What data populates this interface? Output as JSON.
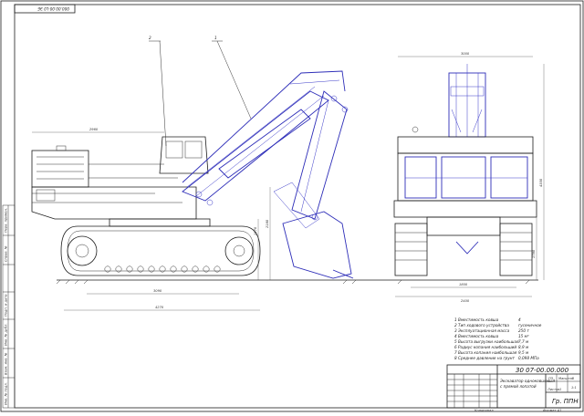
{
  "stamp_code": "000.00.00-L0 ЭЕ",
  "callouts": [
    "2",
    "1"
  ],
  "dimensions": {
    "side_top": "2960",
    "side_h1": "1570",
    "side_h2": "2180",
    "side_base": "3090",
    "side_overall": "4270",
    "front_width": "3000",
    "front_height": "4300",
    "front_lower": "1780",
    "front_track": "1800",
    "front_base": "2400"
  },
  "specs": [
    {
      "num": "1",
      "label": "Вместимость ковша",
      "value": "4"
    },
    {
      "num": "2",
      "label": "Тип ходового устройства",
      "value": "гусеничное"
    },
    {
      "num": "3",
      "label": "Эксплуатационная масса",
      "value": "250 т"
    },
    {
      "num": "4",
      "label": "Вместимость ковша",
      "value": "15 м³"
    },
    {
      "num": "5",
      "label": "Высота выгрузки наибольшая",
      "value": "7,7 м"
    },
    {
      "num": "6",
      "label": "Радиус копания наибольший",
      "value": "8,9 м"
    },
    {
      "num": "7",
      "label": "Высота копания наибольшая",
      "value": "9,5 м"
    },
    {
      "num": "8",
      "label": "Среднее давление на грунт",
      "value": "0,098 МПа"
    }
  ],
  "title_block": {
    "doc_code": "30 07-00.00.000",
    "title_line1": "Экскаватор одноковшовый",
    "title_line2": "с прямой лопатой",
    "group": "Гр. ППН",
    "sheet_label": "Масштаб",
    "scale_value": "1:1",
    "litera": "ПЗ",
    "sheets_label": "Листов",
    "sheets_count": "1",
    "bottom_copy": "Копировал",
    "bottom_format": "Формат А1"
  },
  "left_strip": [
    "Перв. примен.",
    "Справ. №",
    "Подп. и дата",
    "Инв. № дубл.",
    "Взам. инв. №",
    "Подп. и дата",
    "Инв. № подл."
  ]
}
